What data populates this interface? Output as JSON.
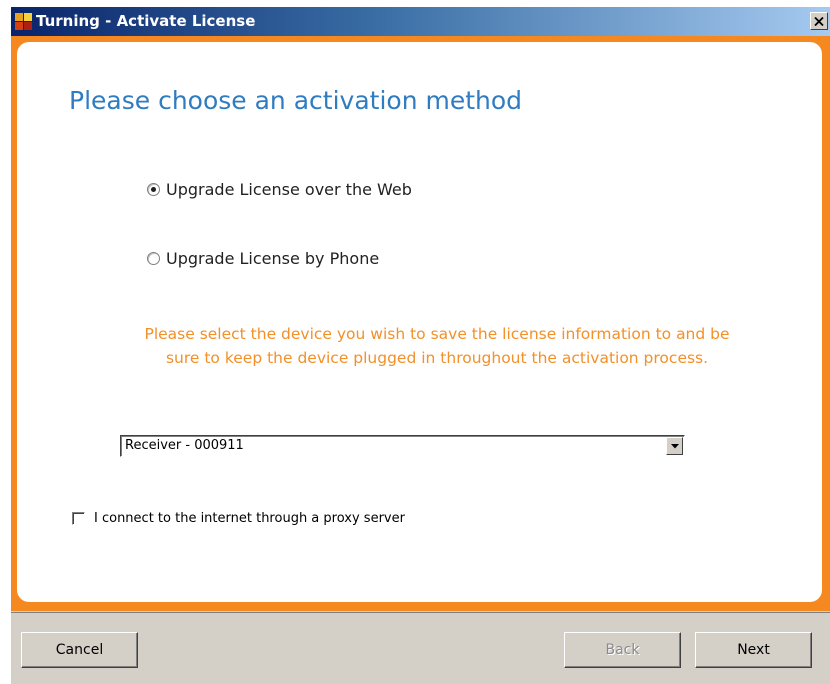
{
  "window": {
    "title": "Turning - Activate License"
  },
  "content": {
    "heading": "Please choose an activation method",
    "options": [
      {
        "label": "Upgrade License over the Web",
        "selected": true
      },
      {
        "label": "Upgrade License by Phone",
        "selected": false
      }
    ],
    "instructions_line1": "Please select the device you wish to save the license information to and be",
    "instructions_line2": "sure to keep the device plugged in throughout the activation process.",
    "device_select": {
      "value": "Receiver - 000911"
    },
    "proxy_checkbox": {
      "label": "I connect to the internet through a proxy server",
      "checked": false
    }
  },
  "buttons": {
    "cancel": "Cancel",
    "back": "Back",
    "next": "Next"
  },
  "colors": {
    "accent_orange": "#f5891f",
    "heading_blue": "#2f7cc0",
    "instruction_orange": "#f39028",
    "title_bar_start": "#0a246a",
    "title_bar_end": "#a6caf0"
  },
  "icons": {
    "app": "turning-app-icon",
    "close": "close-icon",
    "dropdown": "chevron-down-icon"
  }
}
